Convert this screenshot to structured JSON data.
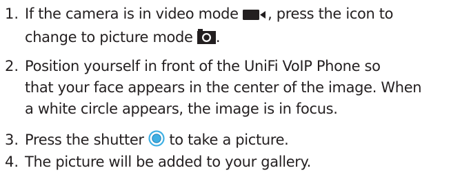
{
  "steps": [
    {
      "number": "1.",
      "line1_before": "If the camera is in video mode ",
      "line1_after": ", press the icon to",
      "line2_before": "change to picture mode ",
      "line2_after": "."
    },
    {
      "number": "2.",
      "lines": [
        "Position yourself in front of the UniFi VoIP Phone so",
        "that your face appears in the center of the image. When",
        "a white circle appears, the image is in focus."
      ]
    },
    {
      "number": "3.",
      "before": "Press the shutter ",
      "after": " to take a picture."
    },
    {
      "number": "4.",
      "text": "The picture will be added to your gallery."
    }
  ],
  "icons": {
    "video": "video-camera-icon",
    "picture": "camera-icon",
    "shutter": "shutter-button-icon"
  },
  "colors": {
    "text": "#231f20",
    "shutter_ring": "#3fb0e4"
  }
}
